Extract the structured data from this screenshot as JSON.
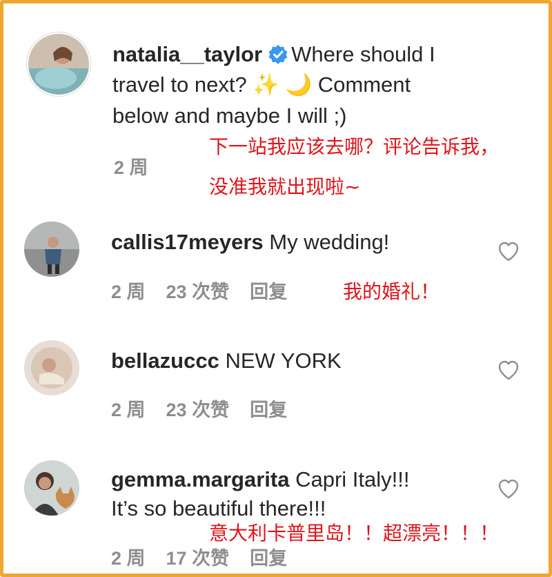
{
  "post": {
    "username": "natalia__taylor",
    "caption_line1": "Where should I",
    "caption_line2": "travel to next? ✨ 🌙  Comment",
    "caption_line3": "below and maybe I will ;)",
    "time": "2 周",
    "translation_line1": "下一站我应该去哪？评论告诉我，",
    "translation_line2": "没准我就出现啦~"
  },
  "comments": [
    {
      "username": "callis17meyers",
      "text_line1": "My wedding!",
      "text_line2": "",
      "time": "2 周",
      "likes": "23 次赞",
      "reply": "回复",
      "translation": "我的婚礼！"
    },
    {
      "username": "bellazuccc",
      "text_line1": "NEW YORK",
      "text_line2": "",
      "time": "2 周",
      "likes": "23 次赞",
      "reply": "回复",
      "translation": ""
    },
    {
      "username": "gemma.margarita",
      "text_line1": "Capri Italy!!!",
      "text_line2": "It’s so beautiful there!!!",
      "time": "2 周",
      "likes": "17 次赞",
      "reply": "回复",
      "translation": "意大利卡普里岛！！超漂亮！！！"
    }
  ],
  "icons": {
    "verified": "verified-badge-icon",
    "like": "heart-icon"
  },
  "colors": {
    "frame": "#f2a531",
    "translation": "#e0131a",
    "verified": "#3897f0",
    "meta": "#8e8e8e"
  }
}
